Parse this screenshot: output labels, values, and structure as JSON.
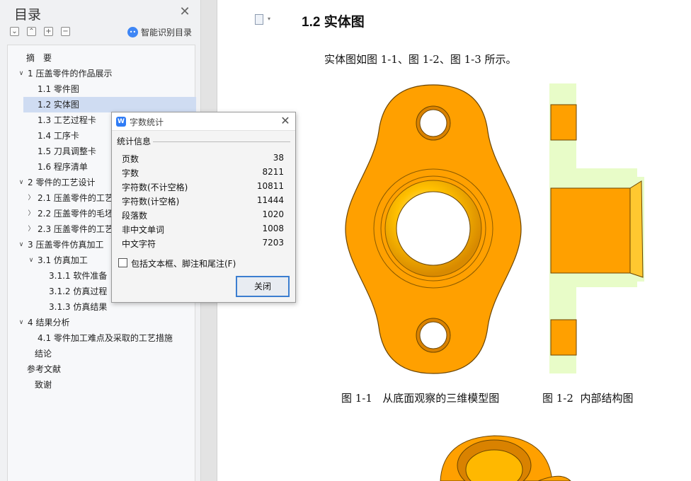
{
  "toc": {
    "title": "目录",
    "smart_label": "智能识别目录",
    "smart_icon": "ai-icon",
    "items": [
      {
        "label": "摘　要",
        "level": 0,
        "arrow": "",
        "selected": false
      },
      {
        "label": "1  压盖零件的作品展示",
        "level": 0,
        "arrow": "down",
        "selected": false
      },
      {
        "label": "1.1 零件图",
        "level": 1,
        "arrow": "",
        "selected": false
      },
      {
        "label": "1.2 实体图",
        "level": 1,
        "arrow": "",
        "selected": true
      },
      {
        "label": "1.3 工艺过程卡",
        "level": 1,
        "arrow": "",
        "selected": false
      },
      {
        "label": "1.4 工序卡",
        "level": 1,
        "arrow": "",
        "selected": false
      },
      {
        "label": "1.5 刀具调整卡",
        "level": 1,
        "arrow": "",
        "selected": false
      },
      {
        "label": "1.6 程序清单",
        "level": 1,
        "arrow": "",
        "selected": false
      },
      {
        "label": "2  零件的工艺设计",
        "level": 0,
        "arrow": "down",
        "selected": false
      },
      {
        "label": "2.1 压盖零件的工艺",
        "level": 1,
        "arrow": "right",
        "selected": false
      },
      {
        "label": "2.2  压盖零件的毛坯",
        "level": 1,
        "arrow": "right",
        "selected": false
      },
      {
        "label": "2.3  压盖零件的工艺",
        "level": 1,
        "arrow": "right",
        "selected": false
      },
      {
        "label": "3  压盖零件仿真加工",
        "level": 0,
        "arrow": "down",
        "selected": false
      },
      {
        "label": "3.1 仿真加工",
        "level": 1,
        "arrow": "down",
        "selected": false
      },
      {
        "label": "3.1.1 软件准备",
        "level": 2,
        "arrow": "",
        "selected": false
      },
      {
        "label": "3.1.2 仿真过程",
        "level": 2,
        "arrow": "",
        "selected": false
      },
      {
        "label": "3.1.3 仿真结果",
        "level": 2,
        "arrow": "",
        "selected": false
      },
      {
        "label": "4  结果分析",
        "level": 0,
        "arrow": "down",
        "selected": false
      },
      {
        "label": "4.1 零件加工难点及采取的工艺措施",
        "level": 1,
        "arrow": "",
        "selected": false
      },
      {
        "label": "结论",
        "level": 0,
        "arrow": "",
        "selected": false
      },
      {
        "label": "参考文献",
        "level": 0,
        "arrow": "",
        "selected": false
      },
      {
        "label": "致谢",
        "level": 0,
        "arrow": "",
        "selected": false
      }
    ]
  },
  "document": {
    "heading": "1.2 实体图",
    "paragraph": "实体图如图 1-1、图 1-2、图 1-3 所示。",
    "caption_1": "图 1-1   从底面观察的三维模型图",
    "caption_2": "图 1-2  内部结构图",
    "part_color": "#ffa000",
    "section_bg_color": "#e8fcc8"
  },
  "dialog": {
    "title": "字数统计",
    "section": "统计信息",
    "stats": [
      {
        "label": "页数",
        "value": "38"
      },
      {
        "label": "字数",
        "value": "8211"
      },
      {
        "label": "字符数(不计空格)",
        "value": "10811"
      },
      {
        "label": "字符数(计空格)",
        "value": "11444"
      },
      {
        "label": "段落数",
        "value": "1020"
      },
      {
        "label": "非中文单词",
        "value": "1008"
      },
      {
        "label": "中文字符",
        "value": "7203"
      }
    ],
    "checkbox_label": "包括文本框、脚注和尾注(F)",
    "checkbox_checked": false,
    "close_button": "关闭"
  }
}
